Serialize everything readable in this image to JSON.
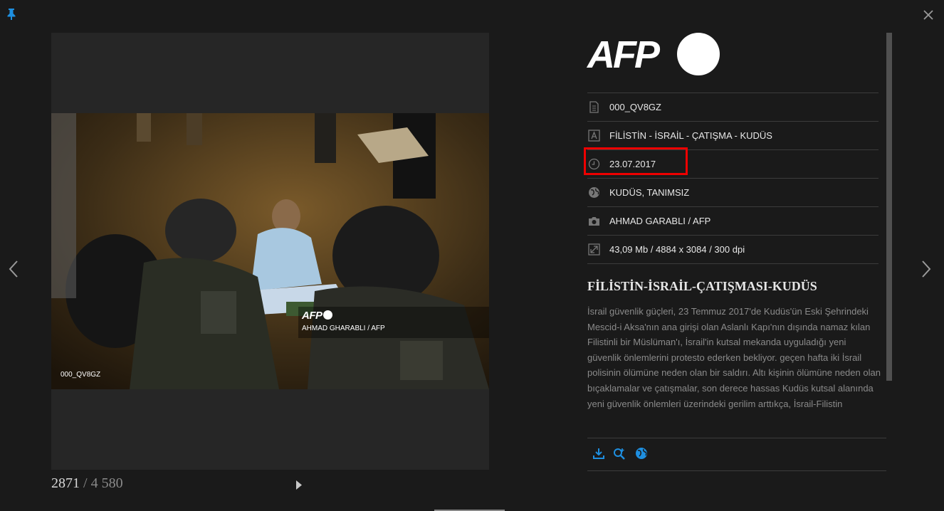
{
  "viewer": {
    "counter_current": "2871",
    "counter_separator": "/",
    "counter_total": "4 580"
  },
  "photo": {
    "watermark_logo": "AFP",
    "watermark_credit": "AHMAD GHARABLI / AFP",
    "reference_id": "000_QV8GZ"
  },
  "panel": {
    "logo_text": "AFP",
    "meta": [
      {
        "icon": "document-icon",
        "value": "000_QV8GZ"
      },
      {
        "icon": "text-letter-icon",
        "value": "FİLİSTİN - İSRAİL - ÇATIŞMA - KUDÜS"
      },
      {
        "icon": "clock-icon",
        "value": "23.07.2017"
      },
      {
        "icon": "globe-icon",
        "value": "KUDÜS, TANIMSIZ"
      },
      {
        "icon": "camera-icon",
        "value": "AHMAD GARABLI / AFP"
      },
      {
        "icon": "resize-icon",
        "value": "43,09 Mb / 4884 x 3084 / 300 dpi"
      }
    ],
    "title": "FİLİSTİN-İSRAİL-ÇATIŞMASI-KUDÜS",
    "body": "İsrail güvenlik güçleri, 23 Temmuz 2017'de Kudüs'ün Eski Şehrindeki Mescid-i Aksa'nın ana girişi olan Aslanlı Kapı'nın dışında namaz kılan Filistinli bir Müslüman'ı, İsrail'in kutsal mekanda uyguladığı yeni güvenlik önlemlerini protesto ederken bekliyor. geçen hafta iki İsrail polisinin ölümüne neden olan bir saldırı. Altı kişinin ölümüne neden olan bıçaklamalar ve çatışmalar, son derece hassas Kudüs kutsal alanında yeni güvenlik önlemleri üzerindeki gerilim arttıkça, İsrail-Filistin",
    "actions": [
      "download-icon",
      "zoom-in-icon",
      "globe-icon"
    ]
  },
  "colors": {
    "background": "#1a1a1a",
    "accent_blue": "#1e8fe0",
    "highlight_red": "#e00000"
  }
}
